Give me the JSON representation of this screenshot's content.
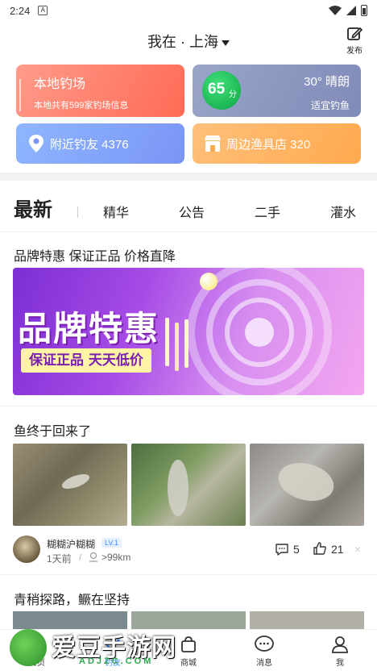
{
  "status_bar": {
    "time": "2:24",
    "sim_badge": "A"
  },
  "header": {
    "location_prefix": "我在 · 上海",
    "publish_label": "发布"
  },
  "cards": {
    "spots": {
      "title": "本地钓场",
      "subtitle": "本地共有599家钓场信息"
    },
    "weather": {
      "score": "65",
      "score_unit": "分",
      "temperature": "30° 晴朗",
      "advice": "适宜钓鱼"
    },
    "friends": {
      "label": "附近钓友 4376"
    },
    "shop": {
      "label": "周边渔具店 320"
    }
  },
  "tabs": [
    {
      "label": "最新",
      "active": true
    },
    {
      "label": "精华"
    },
    {
      "label": "公告"
    },
    {
      "label": "二手"
    },
    {
      "label": "灌水"
    }
  ],
  "ad_post": {
    "title": "品牌特惠 保证正品 价格直降",
    "banner_headline": "品牌特惠",
    "banner_slogan": "保证正品 天天低价"
  },
  "post": {
    "title": "鱼终于回来了",
    "author_name": "糊糊沪糊糊",
    "author_level": "LV.1",
    "time": "1天前",
    "separator": "/",
    "distance": ">99km",
    "comments": "5",
    "likes": "21",
    "close_icon": "×"
  },
  "next_post": {
    "title": "青稍探路，鳜在坚持"
  },
  "bottom_nav": [
    {
      "label": "首页"
    },
    {
      "label": "钓友"
    },
    {
      "label": "商城"
    },
    {
      "label": "消息"
    },
    {
      "label": "我"
    }
  ],
  "watermark": {
    "brand": "爱豆手游网",
    "domain": "ADJZC.COM"
  },
  "colors": {
    "accent_blue": "#3b8bff",
    "spots_red": "#ff6a55",
    "weather_gray": "#7f8bb8",
    "friends_blue": "#7a95f5",
    "shop_orange": "#ffa94f",
    "score_green": "#0fa545"
  }
}
